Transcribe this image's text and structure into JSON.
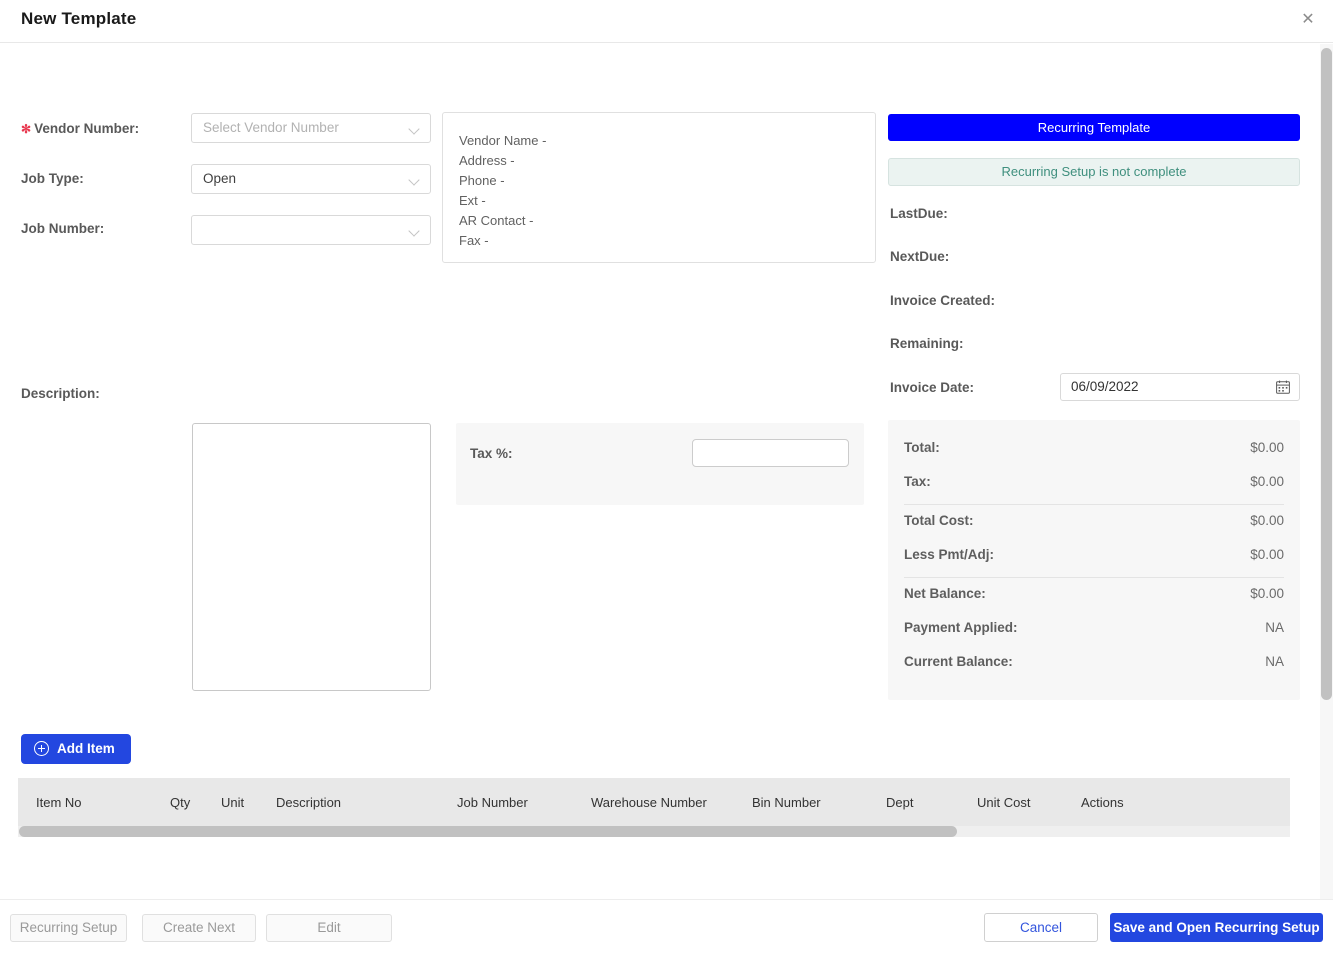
{
  "header": {
    "title": "New Template",
    "close_label": "✕"
  },
  "form": {
    "vendor_number": {
      "label": "Vendor Number:",
      "required_marker": "✻",
      "value": "",
      "placeholder": "Select Vendor Number"
    },
    "job_type": {
      "label": "Job Type:",
      "value": "Open",
      "placeholder": ""
    },
    "job_number": {
      "label": "Job Number:",
      "value": "",
      "placeholder": ""
    },
    "description": {
      "label": "Description:",
      "value": ""
    }
  },
  "vendor_info": {
    "lines": [
      "Vendor Name -",
      "Address -",
      "Phone -",
      "Ext -",
      "AR Contact -",
      "Fax -"
    ]
  },
  "recurring": {
    "button_label": "Recurring Template",
    "button_color": "#0000ff",
    "status_text": "Recurring Setup is not complete",
    "status_color": "#3f8f7e",
    "fields": [
      {
        "label": "LastDue:",
        "value": ""
      },
      {
        "label": "NextDue:",
        "value": ""
      },
      {
        "label": "Invoice Created:",
        "value": ""
      },
      {
        "label": "Remaining:",
        "value": ""
      }
    ],
    "invoice_date": {
      "label": "Invoice Date:",
      "value": "06/09/2022"
    }
  },
  "tax": {
    "label": "Tax %:",
    "value": "",
    "placeholder": ""
  },
  "totals": {
    "rows": [
      {
        "label": "Total:",
        "value": "$0.00"
      },
      {
        "label": "Tax:",
        "value": "$0.00"
      },
      {
        "label": "Total Cost:",
        "value": "$0.00"
      },
      {
        "label": "Less Pmt/Adj:",
        "value": "$0.00"
      },
      {
        "label": "Net Balance:",
        "value": "$0.00"
      },
      {
        "label": "Payment Applied:",
        "value": "NA"
      },
      {
        "label": "Current Balance:",
        "value": "NA"
      }
    ]
  },
  "items_table": {
    "add_item_label": "Add Item",
    "columns": [
      "Item No",
      "Qty",
      "Unit",
      "Description",
      "Job Number",
      "Warehouse Number",
      "Bin Number",
      "Dept",
      "Unit Cost",
      "Actions"
    ],
    "rows": []
  },
  "footer": {
    "recurring_setup_label": "Recurring Setup",
    "create_next_label": "Create Next",
    "edit_label": "Edit",
    "cancel_label": "Cancel",
    "save_label": "Save and Open Recurring Setup"
  }
}
